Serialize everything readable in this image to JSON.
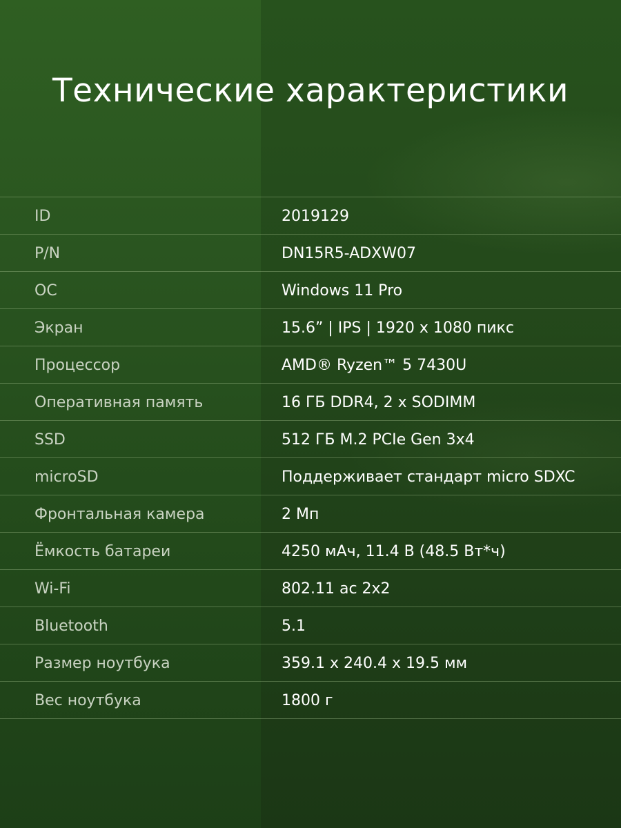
{
  "title": "Технические характеристики",
  "specs": [
    {
      "label": "ID",
      "value": "2019129"
    },
    {
      "label": "P/N",
      "value": "DN15R5-ADXW07"
    },
    {
      "label": "ОС",
      "value": "Windows 11 Pro"
    },
    {
      "label": "Экран",
      "value": "15.6” | IPS | 1920 x 1080 пикс"
    },
    {
      "label": "Процессор",
      "value": "AMD® Ryzen™ 5 7430U"
    },
    {
      "label": "Оперативная память",
      "value": "16 ГБ DDR4, 2 x SODIMM"
    },
    {
      "label": "SSD",
      "value": "512 ГБ M.2 PCIe Gen 3x4"
    },
    {
      "label": "microSD",
      "value": "Поддерживает стандарт micro SDXC"
    },
    {
      "label": "Фронтальная камера",
      "value": "2 Мп"
    },
    {
      "label": "Ёмкость батареи",
      "value": "4250 мАч, 11.4 В (48.5 Вт*ч)"
    },
    {
      "label": "Wi-Fi",
      "value": "802.11 ac 2x2"
    },
    {
      "label": "Bluetooth",
      "value": "5.1"
    },
    {
      "label": "Размер ноутбука",
      "value": "359.1 x 240.4 x 19.5 мм"
    },
    {
      "label": "Вес ноутбука",
      "value": "1800 г"
    }
  ]
}
